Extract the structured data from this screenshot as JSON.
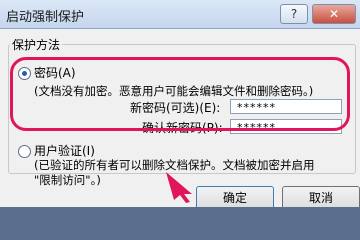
{
  "window": {
    "title": "启动强制保护",
    "help_label": "?",
    "close_label": "✕"
  },
  "group": {
    "title": "保护方法"
  },
  "password_option": {
    "label": "密码(A)",
    "description": "(文档没有加密。恶意用户可能会编辑文件和删除密码。)",
    "new_password_label": "新密码(可选)(E):",
    "new_password_value": "******",
    "confirm_password_label": "确认新密码(P):",
    "confirm_password_value": "******",
    "selected": true
  },
  "user_auth_option": {
    "label": "用户验证(I)",
    "description_line1": "(已验证的所有者可以删除文档保护。文档被加密并启用",
    "description_line2": "\"限制访问\"。)"
  },
  "buttons": {
    "ok": "确定",
    "cancel": "取消"
  },
  "colors": {
    "highlight": "#e0155a",
    "input_fill": "#ffffff"
  }
}
